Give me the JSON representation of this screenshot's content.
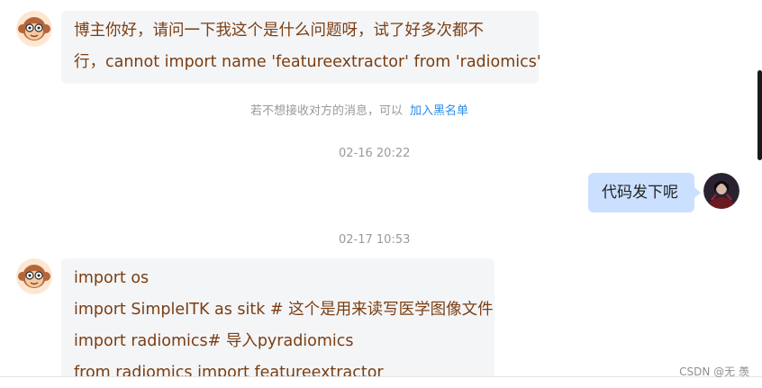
{
  "messages": {
    "first": {
      "line1": "博主你好，请问一下我这个是什么问题呀，试了好多次都不",
      "line2": "行，cannot import name 'featureextractor' from 'radiomics'"
    },
    "notice": {
      "text": "若不想接收对方的消息，可以",
      "link": "加入黑名单"
    },
    "time1": "02-16 20:22",
    "reply": "代码发下呢",
    "time2": "02-17 10:53",
    "code": {
      "line1": "import os",
      "line2": "import SimpleITK as sitk # 这个是用来读写医学图像文件",
      "line3": "import radiomics# 导入pyradiomics",
      "line4": "from radiomics import featureextractor"
    }
  },
  "watermark": "CSDN @无 羡",
  "icons": {
    "left_avatar": "monkey-avatar-icon",
    "right_avatar": "user-photo-avatar"
  },
  "colors": {
    "incoming_text": "#7a3e12",
    "incoming_bubble": "#f4f5f7",
    "outgoing_bubble": "#cbe0ff",
    "link": "#2a8de6"
  }
}
